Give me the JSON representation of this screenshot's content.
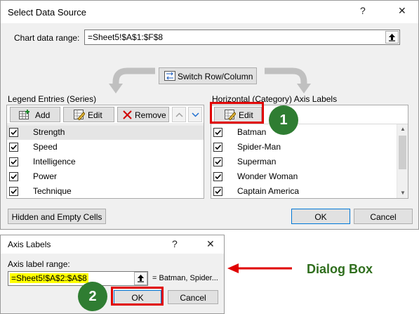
{
  "select_data_source": {
    "title": "Select Data Source",
    "help": "?",
    "close": "✕",
    "chart_range_label": "Chart data range:",
    "chart_range_value": "=Sheet5!$A$1:$F$8",
    "switch_label": "Switch Row/Column",
    "legend_title": "Legend Entries (Series)",
    "legend_buttons": {
      "add": "Add",
      "edit": "Edit",
      "remove": "Remove"
    },
    "series": [
      {
        "label": "Strength",
        "checked": true,
        "selected": true
      },
      {
        "label": "Speed",
        "checked": true
      },
      {
        "label": "Intelligence",
        "checked": true
      },
      {
        "label": "Power",
        "checked": true
      },
      {
        "label": "Technique",
        "checked": true
      }
    ],
    "axis_title": "Horizontal (Category) Axis Labels",
    "axis_edit": "Edit",
    "categories": [
      {
        "label": "Batman",
        "checked": true
      },
      {
        "label": "Spider-Man",
        "checked": true
      },
      {
        "label": "Superman",
        "checked": true
      },
      {
        "label": "Wonder Woman",
        "checked": true
      },
      {
        "label": "Captain America",
        "checked": true
      }
    ],
    "hidden_cells": "Hidden and Empty Cells",
    "ok": "OK",
    "cancel": "Cancel"
  },
  "axis_labels_dialog": {
    "title": "Axis Labels",
    "help": "?",
    "close": "✕",
    "range_label": "Axis label range:",
    "range_value": "=Sheet5!$A$2:$A$8",
    "preview": "= Batman, Spider...",
    "ok": "OK",
    "cancel": "Cancel"
  },
  "annotations": {
    "badge1": "1",
    "badge2": "2",
    "dialog_box": "Dialog Box"
  },
  "colors": {
    "highlight": "#ffff00",
    "red_frame": "#e00000",
    "badge_green": "#2f7d32",
    "annot_text": "#2f6e1d"
  }
}
